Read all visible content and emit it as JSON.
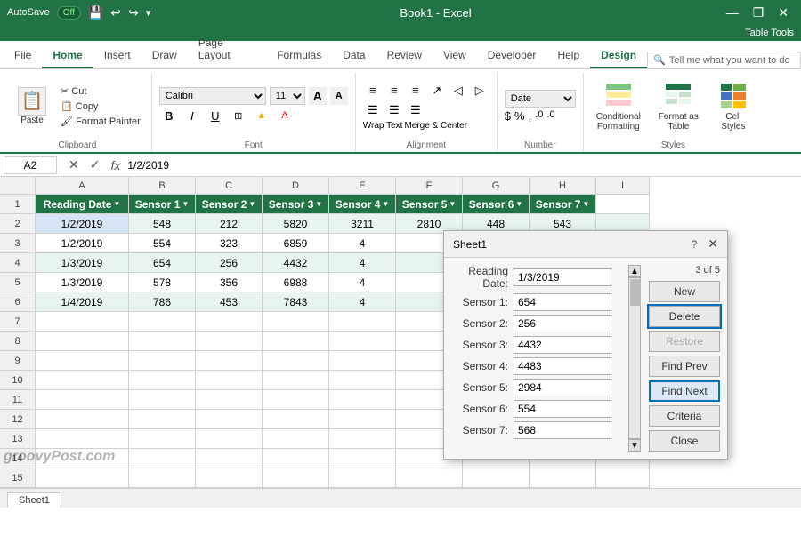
{
  "titleBar": {
    "autosave": "AutoSave",
    "autosave_state": "Off",
    "title": "Book1 - Excel",
    "table_tools": "Table Tools",
    "undo": "↩",
    "redo": "↪",
    "save": "💾",
    "minimize": "—",
    "restore": "❐",
    "close": "✕"
  },
  "ribbonTabs": [
    "File",
    "Home",
    "Insert",
    "Draw",
    "Page Layout",
    "Formulas",
    "Data",
    "Review",
    "View",
    "Developer",
    "Help",
    "Design"
  ],
  "activeTab": "Home",
  "tableToolsTab": "Table Tools",
  "designTab": "Design",
  "searchPlaceholder": "Tell me what you want to do",
  "clipboard": {
    "paste": "Paste",
    "cut": "✂ Cut",
    "copy": "📋 Copy",
    "format_painter": "🖌 Format Painter"
  },
  "font": {
    "name": "Calibri",
    "size": "11",
    "grow": "A",
    "shrink": "A",
    "bold": "B",
    "italic": "I",
    "underline": "U"
  },
  "alignment": {
    "wrap_text": "Wrap Text",
    "merge_center": "Merge & Center"
  },
  "number": {
    "format": "Date"
  },
  "styles": {
    "conditional_formatting": "Conditional\nFormatting",
    "format_as_table": "Format as\nTable",
    "cell_styles": "Cell\nStyles"
  },
  "formulaBar": {
    "name_box": "A2",
    "cancel": "✕",
    "confirm": "✓",
    "formula_icon": "fx",
    "value": "1/2/2019"
  },
  "columns": [
    "A",
    "B",
    "C",
    "D",
    "E",
    "F",
    "G",
    "H",
    "I"
  ],
  "headers": [
    "Reading Date",
    "Sensor 1",
    "Sensor 2",
    "Sensor 3",
    "Sensor 4",
    "Sensor 5",
    "Sensor 6",
    "Sensor 7"
  ],
  "rows": [
    {
      "num": 2,
      "data": [
        "1/2/2019",
        "548",
        "212",
        "5820",
        "3211",
        "2810",
        "448",
        "543"
      ]
    },
    {
      "num": 3,
      "data": [
        "1/2/2019",
        "554",
        "323",
        "6859",
        "4...",
        "",
        "",
        ""
      ]
    },
    {
      "num": 4,
      "data": [
        "1/3/2019",
        "654",
        "256",
        "4432",
        "4...",
        "",
        "",
        ""
      ]
    },
    {
      "num": 5,
      "data": [
        "1/3/2019",
        "578",
        "356",
        "6988",
        "4...",
        "",
        "",
        ""
      ]
    },
    {
      "num": 6,
      "data": [
        "1/4/2019",
        "786",
        "453",
        "7843",
        "4...",
        "",
        "",
        ""
      ]
    },
    {
      "num": 7,
      "data": [
        "",
        "",
        "",
        "",
        "",
        "",
        "",
        ""
      ]
    },
    {
      "num": 8,
      "data": [
        "",
        "",
        "",
        "",
        "",
        "",
        "",
        ""
      ]
    },
    {
      "num": 9,
      "data": [
        "",
        "",
        "",
        "",
        "",
        "",
        "",
        ""
      ]
    },
    {
      "num": 10,
      "data": [
        "",
        "",
        "",
        "",
        "",
        "",
        "",
        ""
      ]
    },
    {
      "num": 11,
      "data": [
        "",
        "",
        "",
        "",
        "",
        "",
        "",
        ""
      ]
    },
    {
      "num": 12,
      "data": [
        "",
        "",
        "",
        "",
        "",
        "",
        "",
        ""
      ]
    },
    {
      "num": 13,
      "data": [
        "",
        "",
        "",
        "",
        "",
        "",
        "",
        ""
      ]
    },
    {
      "num": 14,
      "data": [
        "",
        "",
        "",
        "",
        "",
        "",
        "",
        ""
      ]
    },
    {
      "num": 15,
      "data": [
        "",
        "",
        "",
        "",
        "",
        "",
        "",
        ""
      ]
    }
  ],
  "dialog": {
    "title": "Sheet1",
    "help": "?",
    "close": "✕",
    "record_info": "3 of 5",
    "fields": [
      {
        "label": "Reading Date:",
        "value": "1/3/2019"
      },
      {
        "label": "Sensor 1:",
        "value": "654"
      },
      {
        "label": "Sensor 2:",
        "value": "256"
      },
      {
        "label": "Sensor 3:",
        "value": "4432"
      },
      {
        "label": "Sensor 4:",
        "value": "4483"
      },
      {
        "label": "Sensor 5:",
        "value": "2984"
      },
      {
        "label": "Sensor 6:",
        "value": "554"
      },
      {
        "label": "Sensor 7:",
        "value": "568"
      }
    ],
    "buttons": [
      "New",
      "Delete",
      "Restore",
      "Find Prev",
      "Find Next",
      "Criteria",
      "Close"
    ],
    "active_button": "Find Next",
    "focused_button": "Delete"
  },
  "sheetTab": "Sheet1",
  "watermark": "groovyPost.com"
}
